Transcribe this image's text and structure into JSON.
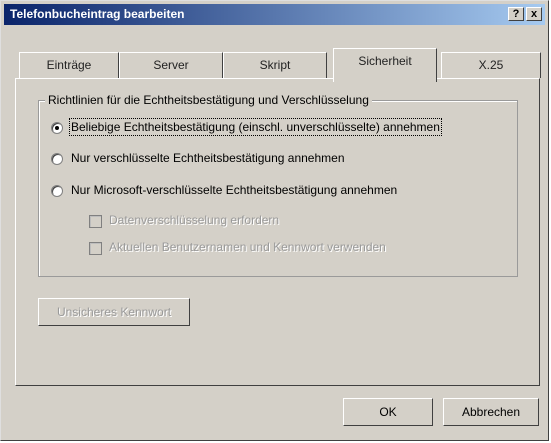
{
  "window": {
    "title": "Telefonbucheintrag bearbeiten",
    "help_glyph": "?",
    "close_glyph": "x"
  },
  "tabs": [
    {
      "label": "Einträge"
    },
    {
      "label": "Server"
    },
    {
      "label": "Skript"
    },
    {
      "label": "Sicherheit",
      "active": true
    },
    {
      "label": "X.25"
    }
  ],
  "group": {
    "label": "Richtlinien für die Echtheitsbestätigung und Verschlüsselung",
    "options": [
      {
        "label": "Beliebige Echtheitsbestätigung (einschl. unverschlüsselte) annehmen",
        "selected": true
      },
      {
        "label": "Nur verschlüsselte Echtheitsbestätigung annehmen",
        "selected": false
      },
      {
        "label": "Nur Microsoft-verschlüsselte Echtheitsbestätigung annehmen",
        "selected": false
      }
    ],
    "checkboxes": [
      {
        "label": "Datenverschlüsselung erfordern",
        "enabled": false
      },
      {
        "label": "Aktuellen Benutzernamen und Kennwort verwenden",
        "enabled": false
      }
    ]
  },
  "unsafe_password_button": "Unsicheres Kennwort",
  "buttons": {
    "ok": "OK",
    "cancel": "Abbrechen"
  }
}
